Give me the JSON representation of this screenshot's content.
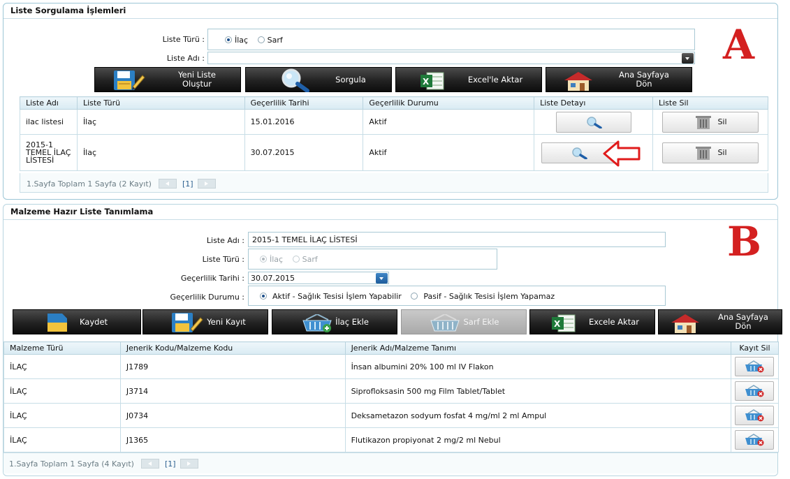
{
  "panelA": {
    "title": "Liste Sorgulama İşlemleri",
    "big_letter": "A",
    "liste_turu_label": "Liste Türü :",
    "radio_ilac": "İlaç",
    "radio_sarf": "Sarf",
    "liste_adi_label": "Liste Adı :",
    "liste_adi_value": "",
    "buttons": {
      "yeni_liste": [
        "Yeni Liste",
        "Oluştur"
      ],
      "sorgula": "Sorgula",
      "excel": "Excel'le Aktar",
      "ana_sayfa": [
        "Ana Sayfaya",
        "Dön"
      ]
    },
    "table": {
      "headers": [
        "Liste Adı",
        "Liste Türü",
        "Geçerlilik Tarihi",
        "Geçerlilik Durumu",
        "Liste Detayı",
        "Liste Sil"
      ],
      "rows": [
        {
          "adi": "ilac listesi",
          "turu": "İlaç",
          "tarih": "15.01.2016",
          "durum": "Aktif",
          "sil": "Sil"
        },
        {
          "adi": "2015-1 TEMEL İLAÇ LİSTESİ",
          "turu": "İlaç",
          "tarih": "30.07.2015",
          "durum": "Aktif",
          "sil": "Sil"
        }
      ]
    },
    "pager": {
      "text": "1.Sayfa Toplam 1 Sayfa (2 Kayıt)",
      "page": "[1]"
    }
  },
  "panelB": {
    "title": "Malzeme Hazır Liste Tanımlama",
    "big_letter": "B",
    "liste_adi_label": "Liste Adı :",
    "liste_adi_value": "2015-1 TEMEL İLAÇ LİSTESİ",
    "liste_turu_label": "Liste Türü :",
    "radio_ilac": "İlaç",
    "radio_sarf": "Sarf",
    "gecerlilik_tarihi_label": "Geçerlilik Tarihi :",
    "gecerlilik_tarihi_value": "30.07.2015",
    "gecerlilik_durumu_label": "Geçerlilik Durumu :",
    "radio_aktif": "Aktif - Sağlık Tesisi İşlem Yapabilir",
    "radio_pasif": "Pasif - Sağlık Tesisi İşlem Yapamaz",
    "buttons": {
      "kaydet": "Kaydet",
      "yeni_kayit": "Yeni Kayıt",
      "ilac_ekle": "İlaç Ekle",
      "sarf_ekle": "Sarf Ekle",
      "excel": "Excele Aktar",
      "ana_sayfa": [
        "Ana Sayfaya",
        "Dön"
      ]
    },
    "table": {
      "headers": [
        "Malzeme Türü",
        "Jenerik Kodu/Malzeme Kodu",
        "Jenerik Adı/Malzeme Tanımı",
        "Kayıt Sil"
      ],
      "rows": [
        {
          "tur": "İLAÇ",
          "kod": "J1789",
          "ad": "İnsan albumini 20% 100 ml IV Flakon"
        },
        {
          "tur": "İLAÇ",
          "kod": "J3714",
          "ad": "Siprofloksasin 500 mg Film Tablet/Tablet"
        },
        {
          "tur": "İLAÇ",
          "kod": "J0734",
          "ad": "Deksametazon sodyum fosfat 4 mg/ml 2 ml Ampul"
        },
        {
          "tur": "İLAÇ",
          "kod": "J1365",
          "ad": "Flutikazon propiyonat 2 mg/2 ml Nebul"
        }
      ]
    },
    "pager": {
      "text": "1.Sayfa Toplam 1 Sayfa (4 Kayıt)",
      "page": "[1]"
    }
  }
}
